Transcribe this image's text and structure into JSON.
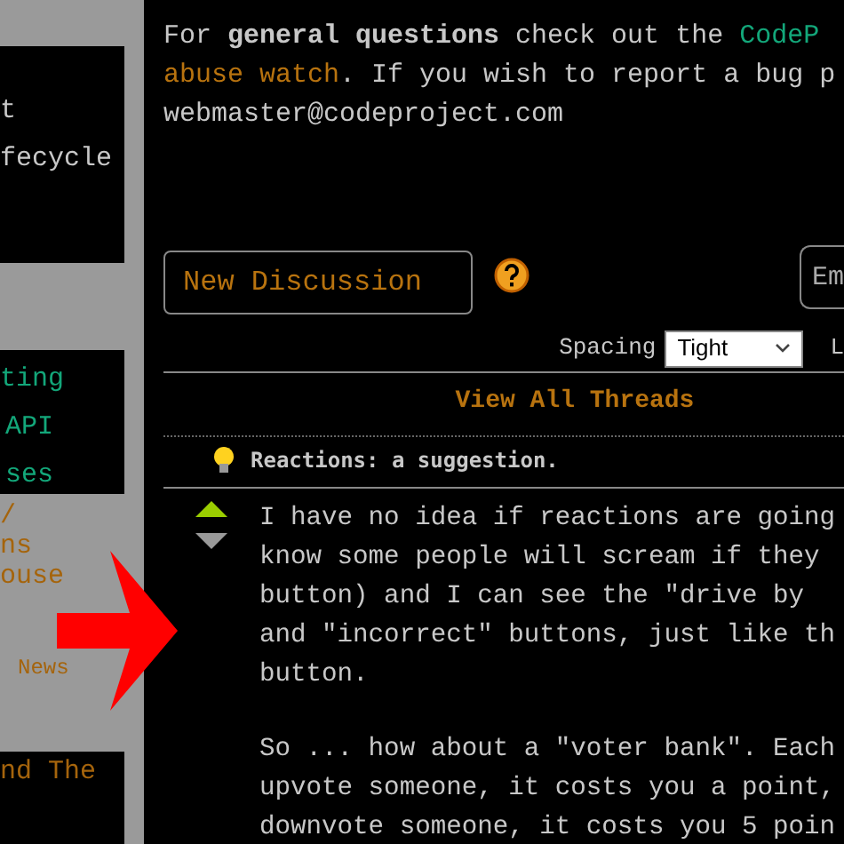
{
  "sidebar": {
    "panels": [
      {
        "kind": "box",
        "items": [
          {
            "text": "t",
            "kind": "plain"
          },
          {
            "text": "fecycle",
            "kind": "plain"
          }
        ]
      },
      {
        "kind": "box",
        "items": [
          {
            "text": "ting",
            "kind": "link"
          },
          {
            "text": "API",
            "kind": "link"
          },
          {
            "text": "ses",
            "kind": "link"
          }
        ]
      },
      {
        "kind": "open",
        "items": [
          {
            "text": "/",
            "kind": "heading"
          },
          {
            "text": "ns",
            "kind": "heading"
          },
          {
            "text": "ouse",
            "kind": "heading"
          },
          {
            "text": "News",
            "kind": "small"
          }
        ]
      },
      {
        "kind": "box",
        "items": [
          {
            "text": "nd The",
            "kind": "heading"
          }
        ]
      }
    ]
  },
  "intro": {
    "lines": [
      [
        {
          "text": "For ",
          "kind": "plain"
        },
        {
          "text": "general questions",
          "kind": "bold"
        },
        {
          "text": " check out the ",
          "kind": "plain"
        },
        {
          "text": "CodeP",
          "kind": "link"
        }
      ],
      [
        {
          "text": "abuse watch",
          "kind": "orange-link"
        },
        {
          "text": ". If you wish to report a bug p",
          "kind": "plain"
        }
      ],
      [
        {
          "text": "webmaster@codeproject.com",
          "kind": "plain"
        }
      ]
    ]
  },
  "toolbar": {
    "new_button": "New Discussion",
    "search": {
      "placeholder": "Em"
    },
    "spacing_label": "Spacing",
    "spacing_value": "Tight",
    "next_label": "L"
  },
  "view_all": "View All Threads",
  "thread": {
    "title": "Reactions: a suggestion.",
    "upvoted": true,
    "downvoted": false,
    "paragraphs": [
      [
        "I have no idea if reactions are going",
        "know some people will scream if they",
        "button) and I can see the \"drive by",
        "and \"incorrect\" buttons, just like th",
        "button."
      ],
      [
        "So ... how about a \"voter bank\". Each",
        "upvote someone, it costs you a point,",
        "downvote someone, it costs you 5 poin"
      ]
    ]
  }
}
